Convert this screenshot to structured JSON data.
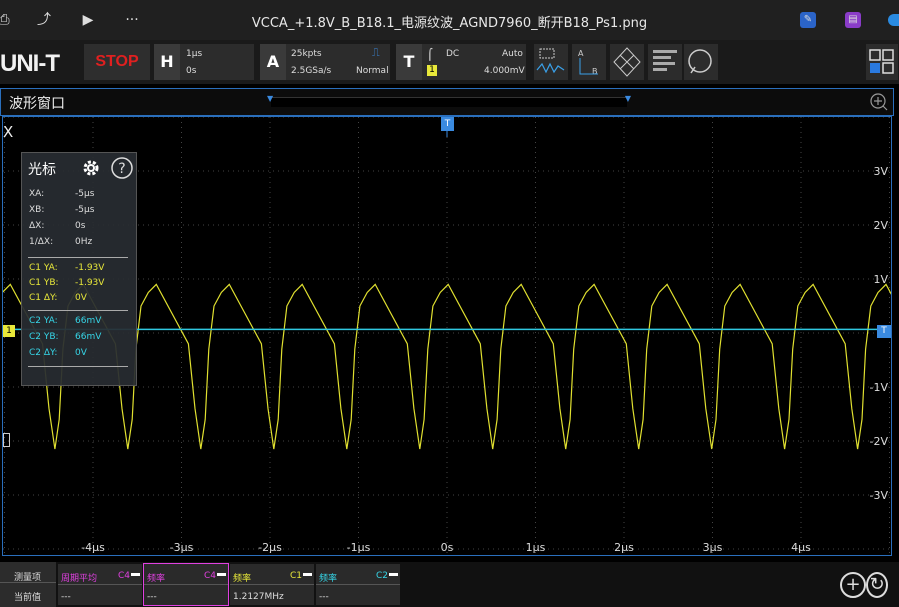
{
  "window": {
    "title": "VCCA_+1.8V_B_B18.1_电源纹波_AGND7960_断开B18_Ps1.png"
  },
  "toolbar": {
    "logo": "UNI-T",
    "run_state": "STOP",
    "horizontal": {
      "letter": "H",
      "scale": "1μs",
      "offset": "0s"
    },
    "acquire": {
      "letter": "A",
      "points": "25kpts",
      "rate": "2.5GSa/s",
      "mode": "Normal"
    },
    "trigger": {
      "letter": "T",
      "coupling": "DC",
      "mode": "Auto",
      "source": "1",
      "level": "4.000mV"
    }
  },
  "waveform_window": {
    "title": "波形窗口"
  },
  "plot": {
    "trigger_marker": "T",
    "ch1_marker": "1",
    "left_label": "X",
    "x_ticks": [
      "-4μs",
      "-3μs",
      "-2μs",
      "-1μs",
      "0s",
      "1μs",
      "2μs",
      "3μs",
      "4μs"
    ],
    "y_ticks": [
      "3V",
      "2V",
      "1V",
      "-1V",
      "-2V",
      "-3V"
    ]
  },
  "cursor_panel": {
    "title": "光标",
    "rows": [
      {
        "label": "XA:",
        "value": "-5μs",
        "color": "#dddddd"
      },
      {
        "label": "XB:",
        "value": "-5μs",
        "color": "#dddddd"
      },
      {
        "label": "ΔX:",
        "value": "0s",
        "color": "#dddddd"
      },
      {
        "label": "1/ΔX:",
        "value": "0Hz",
        "color": "#dddddd"
      },
      {
        "label": "C1 YA:",
        "value": "-1.93V",
        "color": "#e8e83a"
      },
      {
        "label": "C1 YB:",
        "value": "-1.93V",
        "color": "#e8e83a"
      },
      {
        "label": "C1 ΔY:",
        "value": "0V",
        "color": "#e8e83a"
      },
      {
        "label": "C2 YA:",
        "value": "66mV",
        "color": "#36d6e8"
      },
      {
        "label": "C2 YB:",
        "value": "66mV",
        "color": "#36d6e8"
      },
      {
        "label": "C2 ΔY:",
        "value": "0V",
        "color": "#36d6e8"
      }
    ]
  },
  "measure": {
    "header_label": "测量项",
    "header_value": "当前值",
    "cells": [
      {
        "name": "周期平均",
        "channel": "C4",
        "value": "---",
        "color": "#e040e0"
      },
      {
        "name": "频率",
        "channel": "C4",
        "value": "---",
        "color": "#e040e0"
      },
      {
        "name": "频率",
        "channel": "C1",
        "value": "1.2127MHz",
        "color": "#e8e83a"
      },
      {
        "name": "频率",
        "channel": "C2",
        "value": "---",
        "color": "#36d6e8"
      }
    ]
  },
  "colors": {
    "ch1": "#e0e030",
    "ch2": "#30c8e0",
    "accent": "#2a6fbd"
  }
}
